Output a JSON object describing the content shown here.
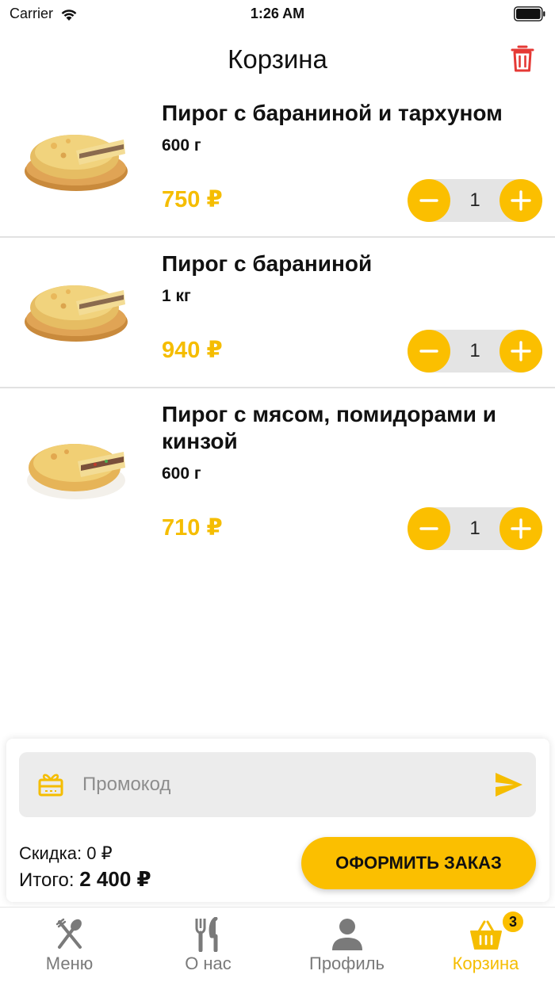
{
  "status_bar": {
    "carrier": "Carrier",
    "time": "1:26 AM"
  },
  "header": {
    "title": "Корзина"
  },
  "cart": {
    "items": [
      {
        "name": "Пирог с бараниной и тархуном",
        "weight": "600 г",
        "price": "750 ₽",
        "quantity": "1"
      },
      {
        "name": "Пирог с бараниной",
        "weight": "1 кг",
        "price": "940 ₽",
        "quantity": "1"
      },
      {
        "name": "Пирог с мясом, помидорами и кинзой",
        "weight": "600 г",
        "price": "710 ₽",
        "quantity": "1"
      }
    ]
  },
  "promo": {
    "placeholder": "Промокод",
    "value": ""
  },
  "summary": {
    "discount_label": "Скидка:",
    "discount_value": "0 ₽",
    "total_label": "Итого:",
    "total_value": "2 400 ₽",
    "checkout_label": "ОФОРМИТЬ ЗАКАЗ"
  },
  "tabs": [
    {
      "label": "Меню",
      "icon": "fork-spoon-icon"
    },
    {
      "label": "О нас",
      "icon": "cutlery-icon"
    },
    {
      "label": "Профиль",
      "icon": "person-icon"
    },
    {
      "label": "Корзина",
      "icon": "basket-icon",
      "badge": "3",
      "active": true
    }
  ],
  "colors": {
    "accent": "#fbbf00",
    "price": "#f5bd00",
    "trash": "#e53935",
    "inactive_tab": "#7a7a7a"
  }
}
